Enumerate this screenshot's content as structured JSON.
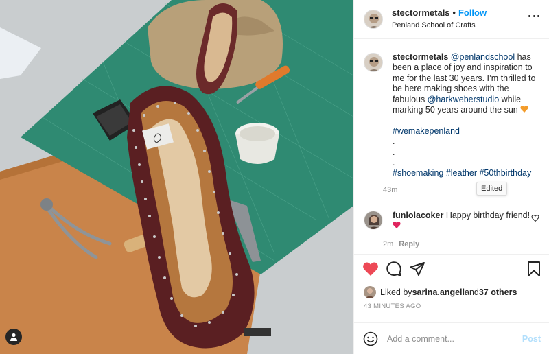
{
  "post": {
    "author": "stectormetals",
    "follow_label": "Follow",
    "location": "Penland School of Crafts",
    "caption": {
      "author": "stectormetals",
      "mention1": "@penlandschool",
      "text1": " has been a place of joy and inspiration to me for the last 30 years. I’m thrilled to be here making shoes with the fabulous ",
      "mention2": "@harkweberstudio",
      "text2": " while marking 50 years around the sun ",
      "hashtag1": "#wemakepenland",
      "dot1": ".",
      "dot2": ".",
      "dot3": ".",
      "hashtags": "#shoemaking #leather #50thbirthday",
      "age": "43m",
      "edited_tooltip": "Edited"
    },
    "comment": {
      "author": "funlolacoker",
      "text": "Happy birthday friend! ",
      "age": "2m",
      "reply_label": "Reply"
    },
    "likes": {
      "prefix": "Liked by ",
      "user": "sarina.angell",
      "and": " and ",
      "others": "37 others"
    },
    "timestamp": "43 MINUTES AGO",
    "add_comment_placeholder": "Add a comment...",
    "post_label": "Post"
  },
  "icons": {
    "like": "heart-filled-icon",
    "comment": "speech-bubble-icon",
    "share": "paper-plane-icon",
    "save": "bookmark-icon",
    "more": "ellipsis-icon",
    "emoji": "smiley-icon",
    "user_tag": "person-icon"
  },
  "colors": {
    "like_red": "#ed4956",
    "follow_blue": "#0095f6",
    "link_navy": "#00376b",
    "post_disabled": "#b2dffc",
    "secondary_text": "#8e8e8e",
    "emoji_orange": "#f39c2b"
  }
}
